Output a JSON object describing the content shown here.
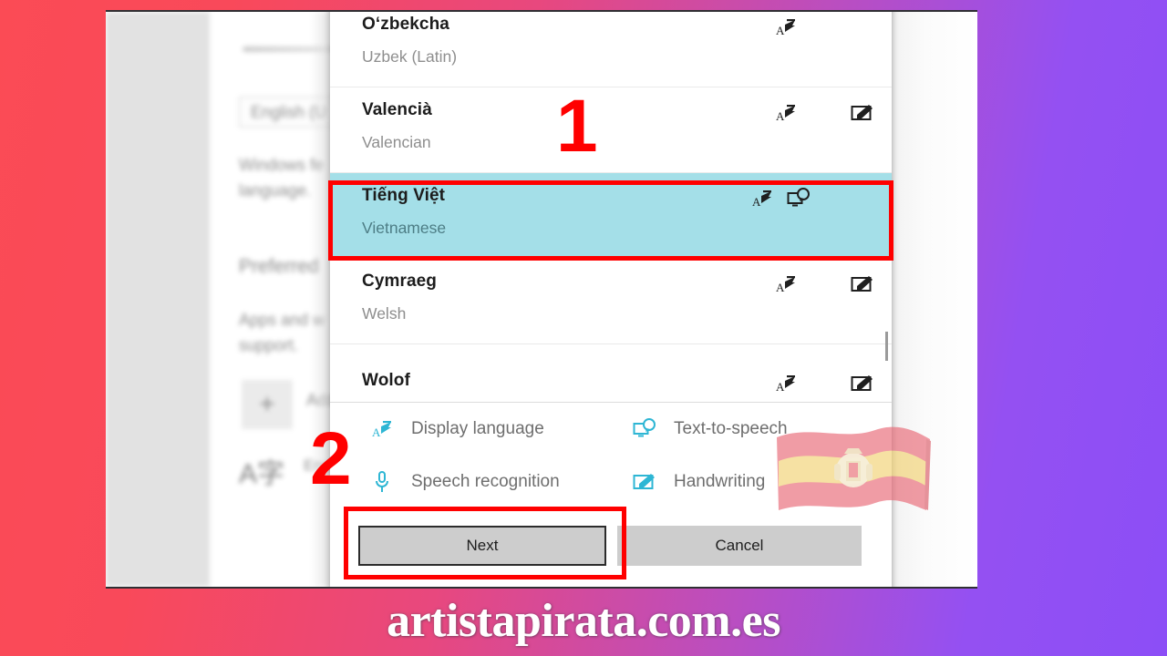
{
  "background_app": {
    "rail_placeholder": "",
    "combobox_value": "English (U",
    "description_line1": "Windows fe",
    "description_line2": "language.",
    "section_heading": "Preferred",
    "section_line1": "Apps and w",
    "section_line2": "support.",
    "add_button_label": "Add",
    "add_icon": "plus-icon",
    "installed_language": "Engl",
    "installed_icon": "language-character-icon",
    "check_icon": "checkmark-icon"
  },
  "dialog": {
    "languages": [
      {
        "native": "Oʻzbekcha",
        "english": "Uzbek (Latin)",
        "icons": [
          "display-language-icon"
        ],
        "selected": false
      },
      {
        "native": "Valencià",
        "english": "Valencian",
        "icons": [
          "display-language-icon",
          "handwriting-icon"
        ],
        "selected": false
      },
      {
        "native": "Tiếng Việt",
        "english": "Vietnamese",
        "icons": [
          "display-language-icon",
          "text-to-speech-icon"
        ],
        "selected": true
      },
      {
        "native": "Cymraeg",
        "english": "Welsh",
        "icons": [
          "display-language-icon",
          "handwriting-icon"
        ],
        "selected": false
      }
    ],
    "partial_language": {
      "native": "Wolof",
      "icons": [
        "display-language-icon",
        "handwriting-icon"
      ]
    },
    "legend": [
      {
        "icon": "display-language-icon",
        "label": "Display language"
      },
      {
        "icon": "text-to-speech-icon",
        "label": "Text-to-speech"
      },
      {
        "icon": "speech-recognition-icon",
        "label": "Speech recognition"
      },
      {
        "icon": "handwriting-icon",
        "label": "Handwriting"
      }
    ],
    "buttons": {
      "next": "Next",
      "cancel": "Cancel"
    },
    "scrollbar": "vertical-scrollbar"
  },
  "annotations": {
    "step_one": "1",
    "step_two": "2",
    "highlight_color": "#ff0000",
    "selection_color": "#a4dfe8"
  },
  "watermark": {
    "text": "artistapirata.com.es"
  },
  "theme": {
    "gradient_start": "#fb4b55",
    "gradient_end": "#8c4ef6",
    "legend_icon_color": "#2eb6d4"
  }
}
